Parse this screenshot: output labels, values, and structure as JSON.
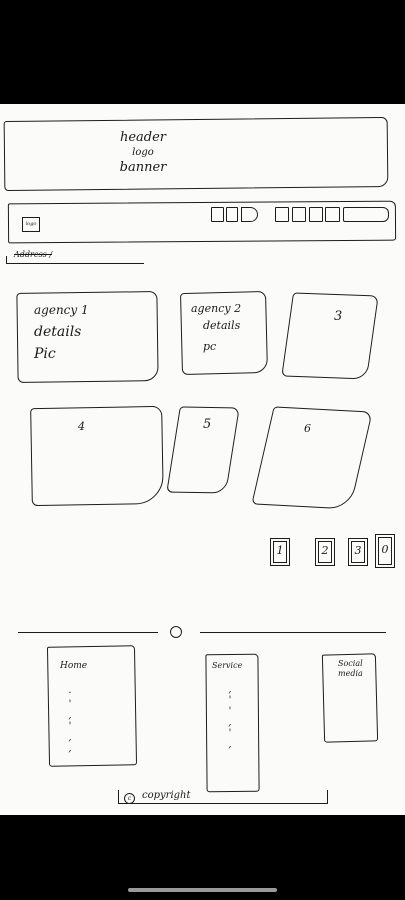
{
  "header": {
    "line1": "header",
    "line2": "logo",
    "line3": "banner"
  },
  "nav": {
    "logo_text": "logo"
  },
  "address": {
    "label": "Address /"
  },
  "cards": [
    {
      "line1": "agency 1",
      "line2": "details",
      "line3": "Pic"
    },
    {
      "line1": "agency 2",
      "line2": "details",
      "line3": "pc"
    },
    {
      "line1": "3"
    },
    {
      "line1": "4"
    },
    {
      "line1": "5"
    },
    {
      "line1": "6"
    }
  ],
  "pagination": [
    "1",
    "2",
    "3",
    "0"
  ],
  "footer": {
    "columns": [
      {
        "label": "Home"
      },
      {
        "label": "Service"
      },
      {
        "label": "Social media"
      }
    ],
    "copyright": "copyright"
  },
  "colors": {
    "ink": "#1d1d1d",
    "paper": "#fbfbf9",
    "frame": "#000000"
  }
}
